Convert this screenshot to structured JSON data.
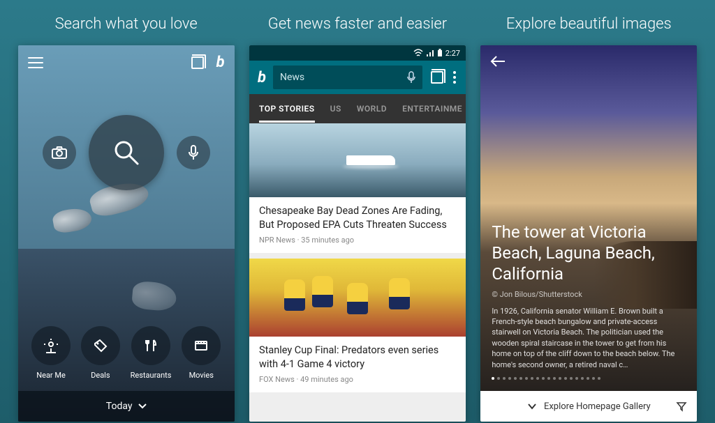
{
  "columns": {
    "search": {
      "title": "Search what you love"
    },
    "news": {
      "title": "Get news faster and easier"
    },
    "images": {
      "title": "Explore beautiful images"
    }
  },
  "phone1": {
    "categories": [
      {
        "icon": "near-me",
        "label": "Near Me"
      },
      {
        "icon": "deals",
        "label": "Deals"
      },
      {
        "icon": "restaurants",
        "label": "Restaurants"
      },
      {
        "icon": "movies",
        "label": "Movies"
      }
    ],
    "today_label": "Today"
  },
  "phone2": {
    "status_time": "2:27",
    "search_value": "News",
    "tabs": [
      "TOP STORIES",
      "US",
      "WORLD",
      "ENTERTAINME"
    ],
    "active_tab": 0,
    "articles": [
      {
        "title": "Chesapeake Bay Dead Zones Are Fading, But Proposed EPA Cuts Threaten Success",
        "source": "NPR News",
        "time": "35 minutes ago"
      },
      {
        "title": "Stanley Cup Final: Predators even series with 4-1 Game 4 victory",
        "source": "FOX News",
        "time": "49 minutes ago"
      }
    ]
  },
  "phone3": {
    "title": "The tower at Victoria Beach, Laguna Beach, California",
    "credit": "© Jon Bilous/Shutterstock",
    "description": "In 1926, California senator William E. Brown built a French-style beach bungalow and private-access stairwell on Victoria Beach. The politician used the wooden spiral staircase in the tower to get from his home on top of the cliff down to the beach below. The home's second owner, a retired naval c…",
    "gallery_label": "Explore Homepage Gallery",
    "dot_count": 20
  }
}
